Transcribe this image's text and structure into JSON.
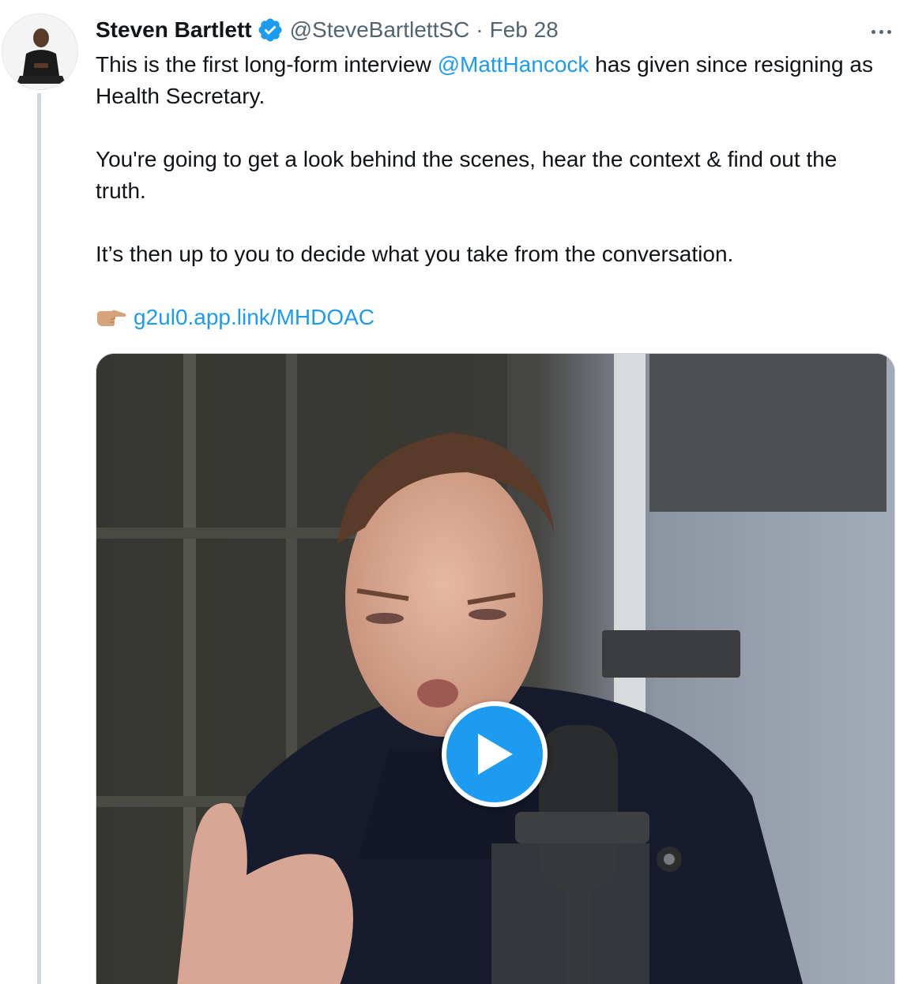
{
  "tweet": {
    "author_name": "Steven Bartlett",
    "author_handle": "@SteveBartlettSC",
    "separator": "·",
    "date": "Feb 28",
    "text": {
      "p1_before": "This is the first long-form interview ",
      "p1_mention": "@MattHancock",
      "p1_after": " has given since resigning as Health Secretary.",
      "p2": "You're going to get a look behind the scenes, hear the context & find out the truth.",
      "p3": "It’s then up to you to decide what you take from the conversation.",
      "link": "g2ul0.app.link/MHDOAC"
    },
    "link_emoji_icon": "backhand-index-pointing-right-icon",
    "media": {
      "type": "video",
      "play_icon": "play-icon"
    }
  },
  "colors": {
    "accent": "#1d9bf0",
    "text_primary": "#0f1419",
    "text_secondary": "#536471",
    "thread_line": "#cfd9de"
  }
}
